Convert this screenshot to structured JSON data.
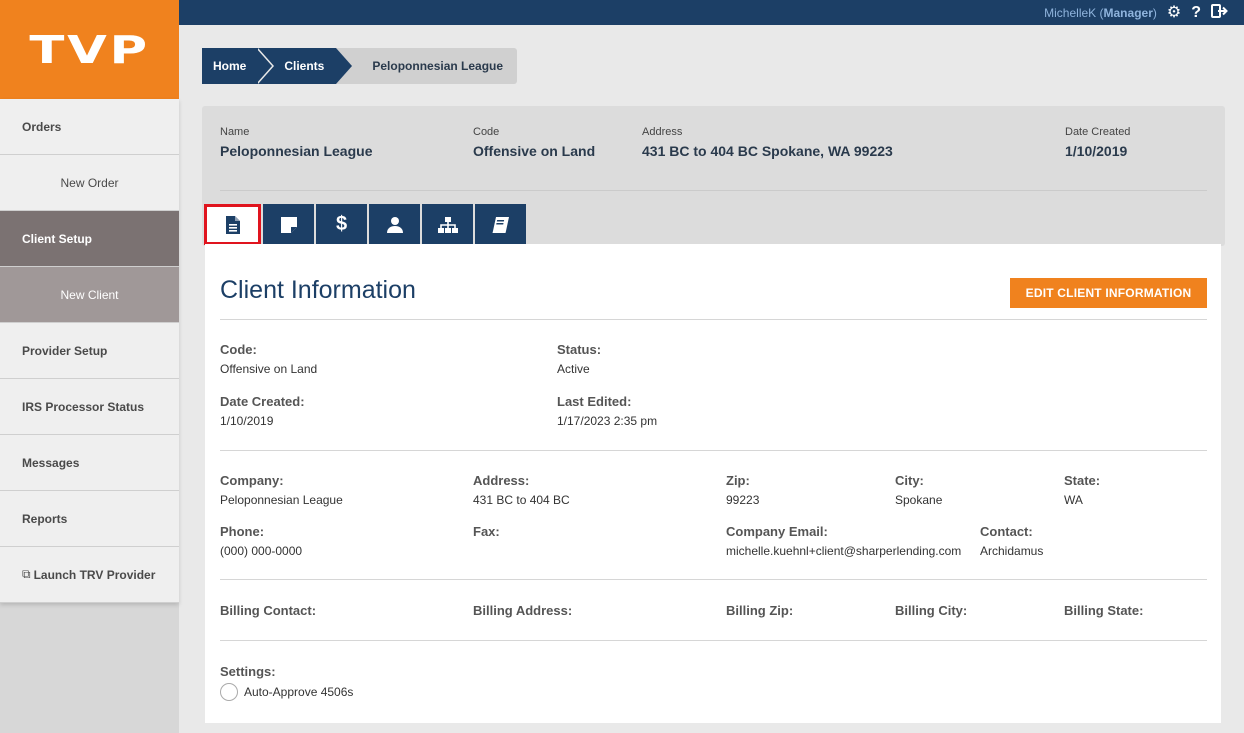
{
  "app": {
    "logo": "TVP"
  },
  "topbar": {
    "user": "MichelleK",
    "role": "Manager",
    "settings_icon": "gear-icon",
    "help_icon": "question-icon",
    "logout_icon": "logout-icon"
  },
  "sidebar": {
    "items": [
      {
        "label": "Orders"
      },
      {
        "label": "New Order"
      },
      {
        "label": "Client Setup"
      },
      {
        "label": "New Client"
      },
      {
        "label": "Provider Setup"
      },
      {
        "label": "IRS Processor Status"
      },
      {
        "label": "Messages"
      },
      {
        "label": "Reports"
      },
      {
        "label": "Launch TRV Provider"
      }
    ]
  },
  "breadcrumb": {
    "home": "Home",
    "clients": "Clients",
    "current": "Peloponnesian League"
  },
  "header": {
    "name_label": "Name",
    "name": "Peloponnesian League",
    "code_label": "Code",
    "code": "Offensive on Land",
    "address_label": "Address",
    "address": "431 BC to 404 BC Spokane, WA 99223",
    "date_label": "Date Created",
    "date": "1/10/2019"
  },
  "tabs": [
    {
      "icon": "document-icon"
    },
    {
      "icon": "note-icon"
    },
    {
      "icon": "dollar-icon"
    },
    {
      "icon": "user-icon"
    },
    {
      "icon": "org-chart-icon"
    },
    {
      "icon": "book-icon"
    }
  ],
  "panel": {
    "title": "Client Information",
    "edit_button": "EDIT CLIENT INFORMATION",
    "code_label": "Code:",
    "code": "Offensive on Land",
    "status_label": "Status:",
    "status": "Active",
    "date_created_label": "Date Created:",
    "date_created": "1/10/2019",
    "last_edited_label": "Last Edited:",
    "last_edited": "1/17/2023 2:35 pm",
    "company_label": "Company:",
    "company": "Peloponnesian League",
    "address_label": "Address:",
    "address": "431 BC to 404 BC",
    "zip_label": "Zip:",
    "zip": "99223",
    "city_label": "City:",
    "city": "Spokane",
    "state_label": "State:",
    "state": "WA",
    "phone_label": "Phone:",
    "phone": "(000) 000-0000",
    "fax_label": "Fax:",
    "email_label": "Company Email:",
    "email": "michelle.kuehnl+client@sharperlending.com",
    "contact_label": "Contact:",
    "contact": "Archidamus",
    "billing_contact_label": "Billing Contact:",
    "billing_address_label": "Billing Address:",
    "billing_zip_label": "Billing Zip:",
    "billing_city_label": "Billing City:",
    "billing_state_label": "Billing State:",
    "settings_label": "Settings:",
    "auto_approve_label": "Auto-Approve 4506s"
  }
}
